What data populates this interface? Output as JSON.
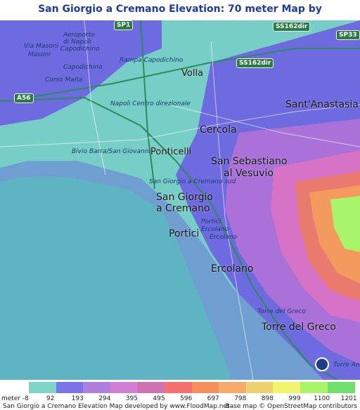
{
  "title": "San Giorgio a Cremano Elevation: 70 meter Map by www.FloodMap.net (beta)",
  "map": {
    "towns": [
      {
        "name": "Volla"
      },
      {
        "name": "Sant'Anastasia"
      },
      {
        "name": "Cercola"
      },
      {
        "name": "Ponticelli"
      },
      {
        "name": "San Sebastiano"
      },
      {
        "name": "al Vesuvio"
      },
      {
        "name": "San Giorgio"
      },
      {
        "name": "a Cremano"
      },
      {
        "name": "Portici"
      },
      {
        "name": "Ercolano"
      },
      {
        "name": "Torre del Greco"
      }
    ],
    "small_labels": [
      {
        "name": "Aeroporto"
      },
      {
        "name": "di Napoli"
      },
      {
        "name": "Capodichino"
      },
      {
        "name": "Via Masoni"
      },
      {
        "name": "Masoni"
      },
      {
        "name": "Capodichino"
      },
      {
        "name": "Rampa Capodichino"
      },
      {
        "name": "Corso Malta"
      },
      {
        "name": "Napoli Centro direzionale"
      },
      {
        "name": "Bivio Barra/San Giovanni"
      },
      {
        "name": "San Giorgio a Cremano sud"
      },
      {
        "name": "Portici"
      },
      {
        "name": "Ercolano"
      },
      {
        "name": "Ercolano"
      },
      {
        "name": "Torre del Greco"
      },
      {
        "name": "Torre Annunziata"
      }
    ],
    "road_shields": [
      {
        "name": "SP1"
      },
      {
        "name": "SS162dir"
      },
      {
        "name": "SP33"
      },
      {
        "name": "SS162dir"
      },
      {
        "name": "A56"
      }
    ],
    "osm_logo": "openstreetmap-logo-icon"
  },
  "legend": {
    "unit_label": "meter -8",
    "ticks": [
      "92",
      "193",
      "294",
      "395",
      "495",
      "596",
      "697",
      "798",
      "898",
      "999",
      "1100",
      "1201"
    ],
    "colors": [
      "#7fd4c9",
      "#7a74e8",
      "#b07fdc",
      "#d17fd2",
      "#cf72b2",
      "#f77070",
      "#f78f5c",
      "#f5ac6a",
      "#efd06f",
      "#f1f56d",
      "#a8f56a",
      "#6fe06b"
    ]
  },
  "footer": {
    "left": "San Giorgio a Cremano Elevation Map developed by www.FloodMap.net",
    "right": "Base map © OpenStreetMap contributors"
  }
}
